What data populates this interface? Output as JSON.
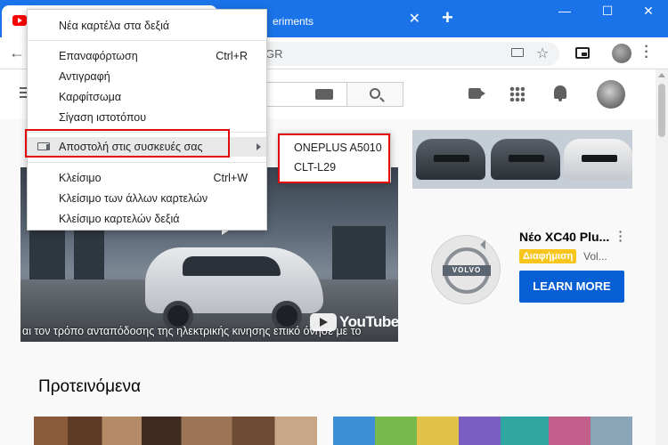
{
  "tabs": {
    "active": {
      "title": ""
    },
    "background": {
      "title": "eriments",
      "close": "✕"
    },
    "new_tab": "+"
  },
  "window_controls": {
    "minimize": "—",
    "maximize": "☐",
    "close": "✕"
  },
  "omnibox": {
    "text": "GR"
  },
  "context_menu": {
    "items": [
      {
        "label": "Νέα καρτέλα στα δεξιά",
        "shortcut": ""
      },
      {
        "label": "Επαναφόρτωση",
        "shortcut": "Ctrl+R"
      },
      {
        "label": "Αντιγραφή",
        "shortcut": ""
      },
      {
        "label": "Καρφίτσωμα",
        "shortcut": ""
      },
      {
        "label": "Σίγαση ιστοτόπου",
        "shortcut": ""
      },
      {
        "label": "Αποστολή στις συσκευές σας",
        "shortcut": ""
      },
      {
        "label": "Κλείσιμο",
        "shortcut": "Ctrl+W"
      },
      {
        "label": "Κλείσιμο των άλλων καρτελών",
        "shortcut": ""
      },
      {
        "label": "Κλείσιμο καρτελών δεξιά",
        "shortcut": ""
      }
    ]
  },
  "devices_submenu": {
    "items": [
      "ONEPLUS A5010",
      "CLT-L29"
    ]
  },
  "video": {
    "caption": "αι τον τρόπο ανταπόδοσης της ηλεκτρικής κινησης επικό   όνησε με το",
    "watermark": "YouTube"
  },
  "ad": {
    "title": "Νέο XC40 Plu...",
    "badge": "Διαφήμιση",
    "advertiser": "Vol...",
    "cta": "LEARN MORE",
    "logo_text": "VOLVO"
  },
  "sections": {
    "recommended": "Προτεινόμενα"
  },
  "colors": {
    "chrome_blue": "#1a73e8",
    "highlight_red": "#e20a0a",
    "learn_more_blue": "#065fd4",
    "ad_badge": "#f8c51c"
  }
}
